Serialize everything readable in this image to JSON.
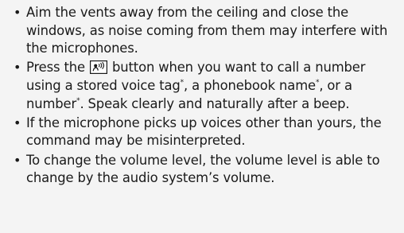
{
  "bullet_char": "•",
  "asterisk": "*",
  "items": [
    {
      "text": "Aim the vents away from the ceiling and close the windows, as noise coming from them may interfere with the microphones."
    },
    {
      "before_icon": "Press the ",
      "icon": "talk-button-icon",
      "after_icon": " button when you want to call a number using a stored voice tag",
      "mid1": ", a phonebook name",
      "mid2": ", or a number",
      "end": ". Speak clearly and naturally after a beep."
    },
    {
      "text": "If the microphone picks up voices other than yours, the command may be misinterpreted."
    },
    {
      "text": "To change the volume level, the volume level is able to change by the audio system’s volume."
    }
  ]
}
